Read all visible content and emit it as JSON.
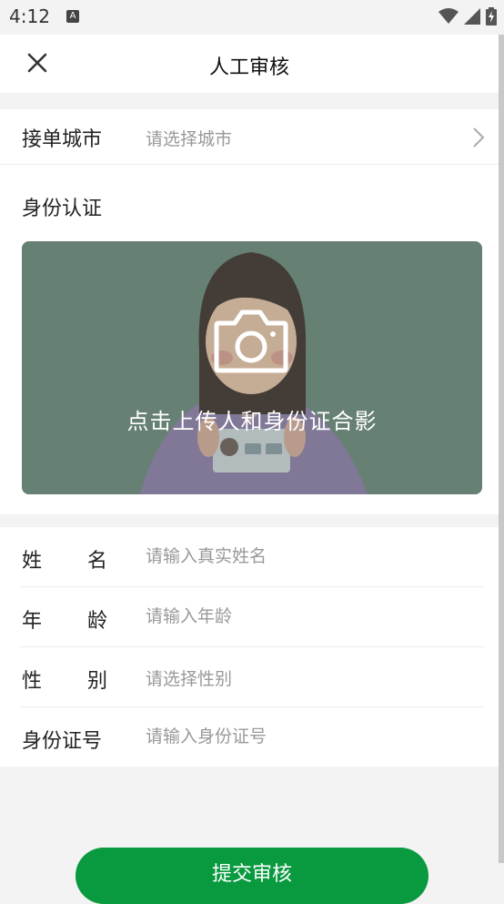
{
  "status_bar": {
    "time": "4:12",
    "notification_icon_letter": "A"
  },
  "header": {
    "title": "人工审核",
    "close_icon": "close-icon"
  },
  "city": {
    "label": "接单城市",
    "placeholder": "请选择城市"
  },
  "identity": {
    "section_title": "身份认证",
    "upload_text": "点击上传人和身份证合影",
    "camera_icon": "camera-icon"
  },
  "form": {
    "name": {
      "label_chars": [
        "姓",
        "名"
      ],
      "placeholder": "请输入真实姓名"
    },
    "age": {
      "label_chars": [
        "年",
        "龄"
      ],
      "placeholder": "请输入年龄"
    },
    "gender": {
      "label_chars": [
        "性",
        "别"
      ],
      "placeholder": "请选择性别"
    },
    "id_number": {
      "label": "身份证号",
      "placeholder": "请输入身份证号"
    }
  },
  "submit": {
    "label": "提交审核"
  },
  "colors": {
    "accent_green": "#099a3f",
    "upload_bg": "#6b8479",
    "placeholder": "#999999"
  }
}
